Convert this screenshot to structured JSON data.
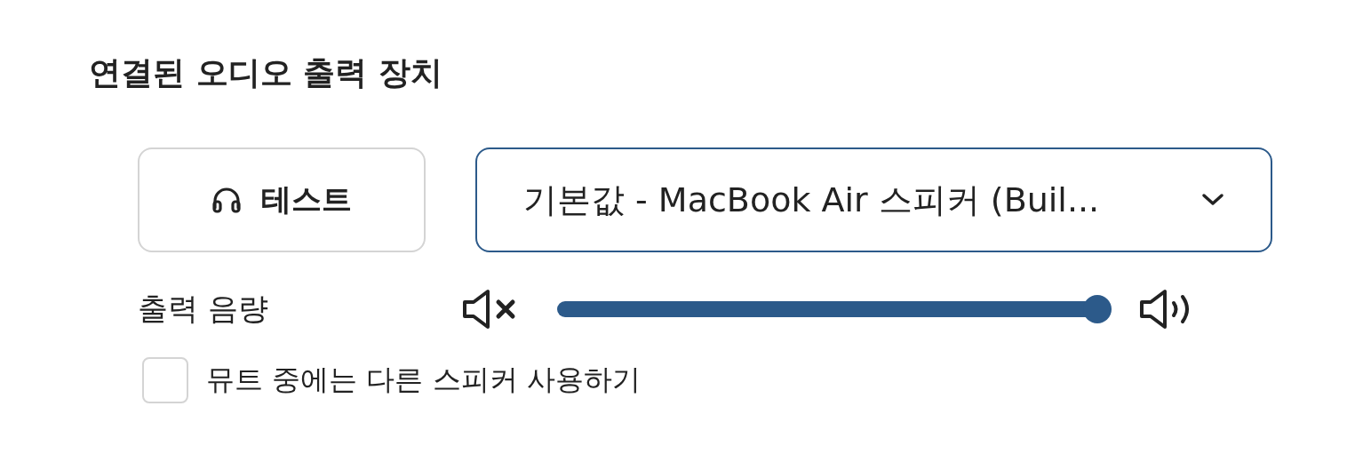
{
  "section": {
    "title": "연결된 오디오 출력 장치"
  },
  "test_button": {
    "label": "테스트"
  },
  "device_select": {
    "value": "기본값 - MacBook Air 스피커 (Buil..."
  },
  "volume": {
    "label": "출력 음량",
    "level": 0.98
  },
  "mute_option": {
    "label": "뮤트 중에는 다른 스피커 사용하기",
    "checked": false
  }
}
